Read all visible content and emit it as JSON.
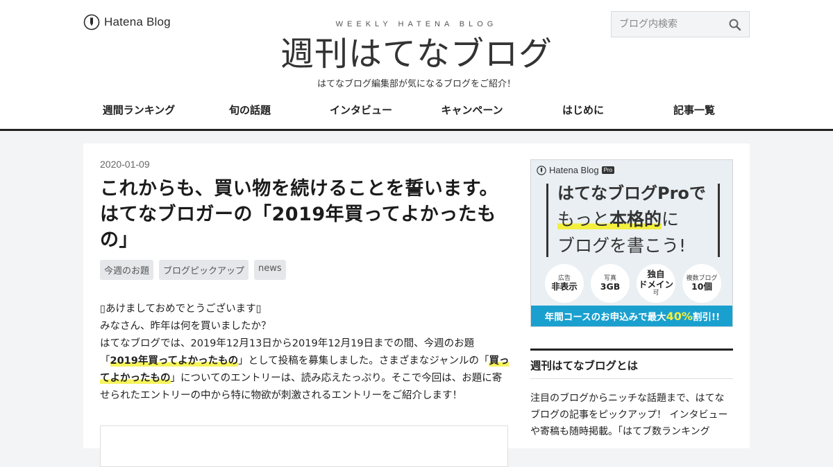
{
  "header": {
    "logo_text": "Hatena Blog",
    "kicker": "WEEKLY HATENA BLOG",
    "title": "週刊はてなブログ",
    "description": "はてなブログ編集部が気になるブログをご紹介！",
    "search_placeholder": "ブログ内検索",
    "search_icon": "search-icon"
  },
  "nav": {
    "items": [
      {
        "label": "週間ランキング"
      },
      {
        "label": "旬の話題"
      },
      {
        "label": "インタビュー"
      },
      {
        "label": "キャンペーン"
      },
      {
        "label": "はじめに"
      },
      {
        "label": "記事一覧"
      }
    ]
  },
  "entry": {
    "date": "2020-01-09",
    "title": "これからも、買い物を続けることを誓います。はてなブロガーの「2019年買ってよかったもの」",
    "tags": [
      "今週のお題",
      "ブログピックアップ",
      "news"
    ],
    "body": {
      "p1": "あけましておめでとうございます",
      "p2": "みなさん、昨年は何を買いましたか？",
      "p3_a": "はてなブログでは、2019年12月13日から2019年12月19日までの間、今週のお題「",
      "p3_hl1": "2019年買ってよかったもの",
      "p3_b": "」として投稿を募集しました。さまざまなジャンルの「",
      "p3_hl2": "買ってよかったもの",
      "p3_c": "」についてのエントリーは、読み応えたっぷり。そこで今回は、お題に寄せられたエントリーの中から特に物欲が刺激されるエントリーをご紹介します！"
    }
  },
  "sidebar": {
    "ad": {
      "logo_text": "Hatena Blog",
      "pro_badge": "Pro",
      "line1": "はてなブログProで",
      "line2_a": "もっと",
      "line2_b": "本格的",
      "line2_c": "に",
      "line3": "ブログを書こう!",
      "circles": [
        {
          "top": "広告",
          "main": "非表示",
          "sub": ""
        },
        {
          "top": "写真",
          "main": "3GB",
          "sub": ""
        },
        {
          "top": "",
          "main": "独自\nドメイン",
          "sub": "可"
        },
        {
          "top": "複数ブログ",
          "main": "10個",
          "sub": ""
        }
      ],
      "bottom_a": "年間コースのお申込みで最大",
      "bottom_pct": "40%",
      "bottom_b": "割引!!",
      "accent_color": "#1aa0cf"
    },
    "about": {
      "title": "週刊はてなブログとは",
      "text": "注目のブログからニッチな話題まで、はてなブログの記事をピックアップ！ インタビューや寄稿も随時掲載。「はてブ数ランキング"
    }
  }
}
